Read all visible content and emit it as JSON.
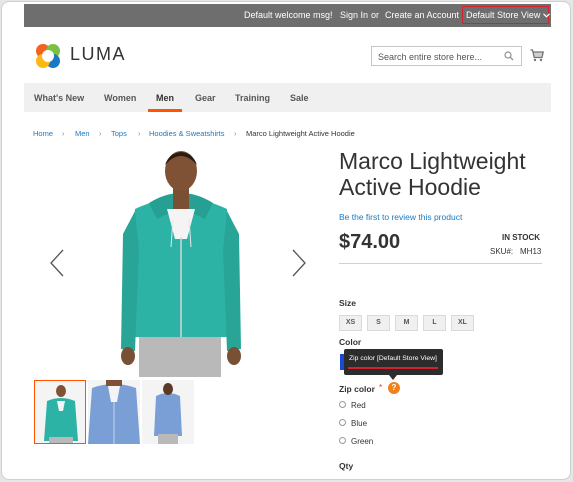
{
  "header": {
    "welcome": "Default welcome msg!",
    "sign_in": "Sign In",
    "or": "or",
    "create_account": "Create an Account",
    "store_view": "Default Store View"
  },
  "logo": {
    "text": "LUMA"
  },
  "search": {
    "placeholder": "Search entire store here..."
  },
  "nav": {
    "items": [
      "What's New",
      "Women",
      "Men",
      "Gear",
      "Training",
      "Sale"
    ],
    "active": "Men"
  },
  "breadcrumbs": {
    "items": [
      "Home",
      "Men",
      "Tops",
      "Hoodies & Sweatshirts"
    ],
    "current": "Marco Lightweight Active Hoodie"
  },
  "product": {
    "title": "Marco Lightweight Active Hoodie",
    "review_link": "Be the first to review this product",
    "price": "$74.00",
    "stock": "IN STOCK",
    "sku_label": "SKU#:",
    "sku": "MH13"
  },
  "options": {
    "size_label": "Size",
    "sizes": [
      "XS",
      "S",
      "M",
      "L",
      "XL"
    ],
    "color_label": "Color",
    "tooltip": "Zip color [Default Store View]",
    "zip_label": "Zip color",
    "required_mark": "*",
    "help_glyph": "?",
    "zip_options": [
      "Red",
      "Blue",
      "Green"
    ],
    "qty_label": "Qty"
  },
  "colors": {
    "accent": "#ff5501",
    "link": "#1979c3",
    "topbar": "#6e6e6e",
    "highlight": "#d0232b",
    "hoodie_teal": "#2db3a6",
    "hoodie_blue": "#7a9fd6",
    "swatch_blue": "#1a49d6"
  }
}
